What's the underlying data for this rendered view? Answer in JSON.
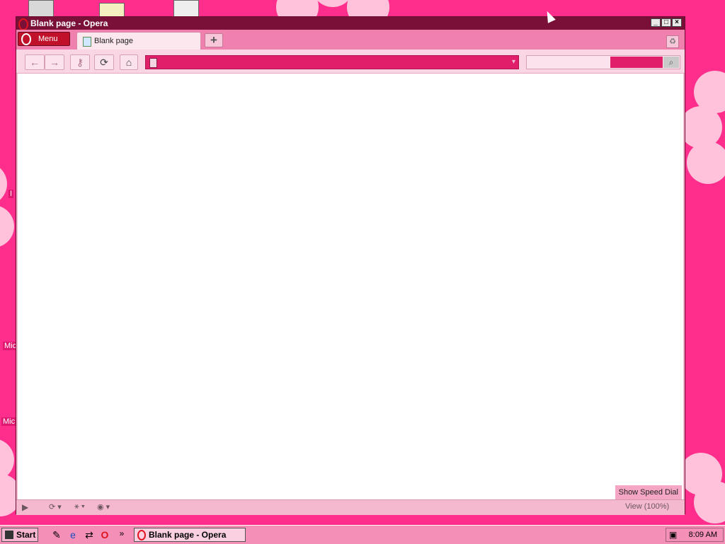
{
  "window": {
    "title": "Blank page - Opera",
    "controls": {
      "minimize": "_",
      "maximize": "□",
      "close": "×"
    }
  },
  "browser": {
    "menu_label": "Menu",
    "tabs": [
      {
        "label": "Blank page",
        "active": true
      }
    ],
    "new_tab_symbol": "+",
    "trash_symbol": "♻",
    "nav": {
      "back": "←",
      "forward": "→",
      "key": "⚷",
      "reload": "⟳",
      "home": "⌂"
    },
    "address_value": "",
    "address_dropdown": "▾",
    "search_button_symbol": "⌕",
    "show_speed_dial": "Show Speed Dial",
    "status": {
      "panel_toggle": "▶",
      "sync": "⟳ ▾",
      "share": "⚹ ▾",
      "turbo": "◉ ▾",
      "zoom": "View (100%)"
    }
  },
  "desktop": {
    "labels": [
      "I",
      "Mic",
      "Mic"
    ]
  },
  "taskbar": {
    "start_label": "Start",
    "chevron": "»",
    "task_label": "Blank page - Opera",
    "clock": "8:09 AM"
  },
  "colors": {
    "wallpaper": "#ff2e8c",
    "titlebar": "#7a0f37",
    "address_bar": "#e01e6a",
    "accent": "#c0102a"
  }
}
